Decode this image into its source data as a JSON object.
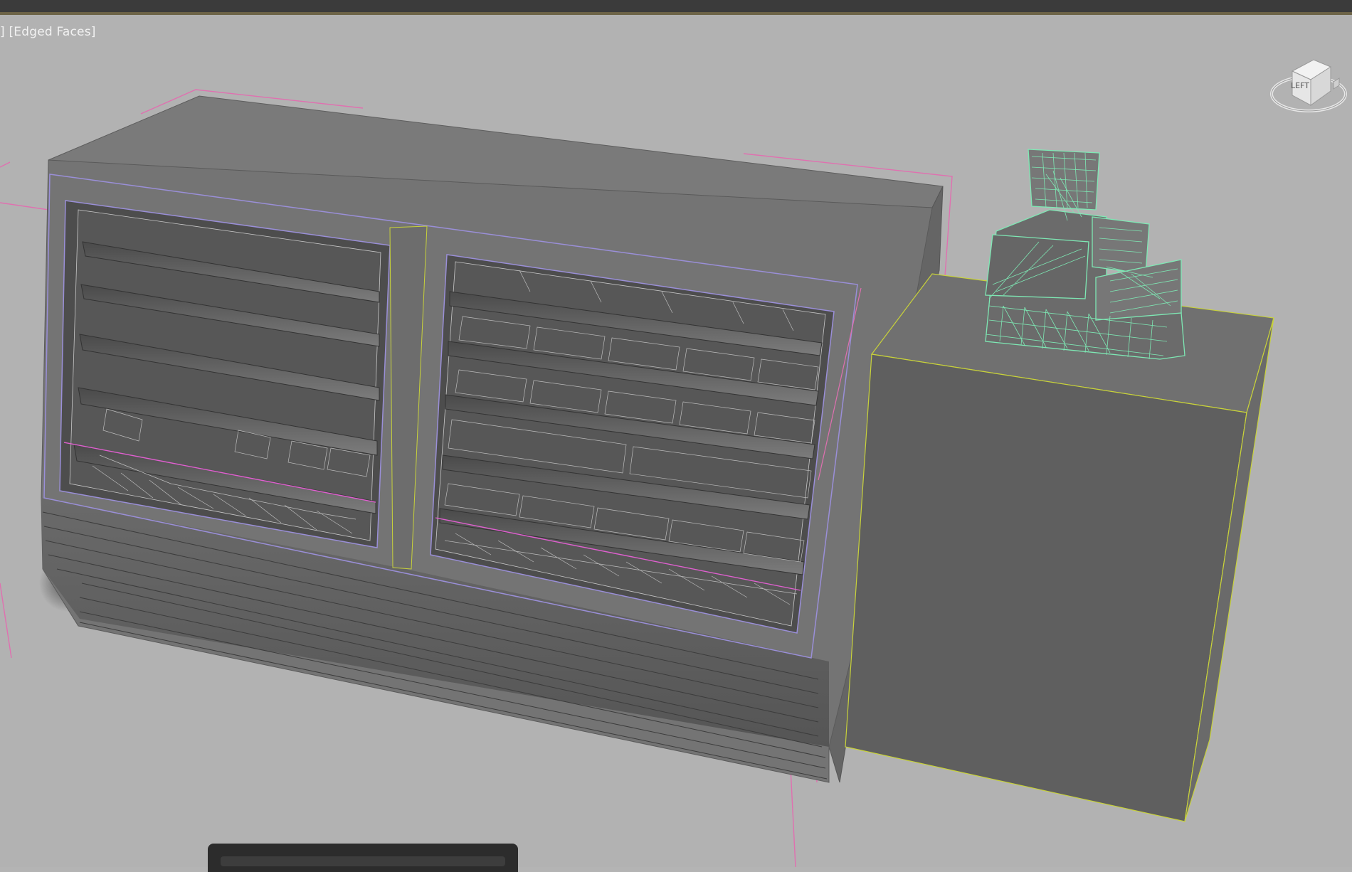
{
  "viewport": {
    "label": "[Edged Faces]",
    "label_prefix": "]"
  },
  "viewcube": {
    "face": "LEFT"
  },
  "colors": {
    "background": "#b2b2b2",
    "fridge_body": "#6e6e6e",
    "selection_wire": "#7ee8b4",
    "bbox_pink": "#e070b0",
    "frame_purple": "#9a8fd8",
    "edge_yellow": "#c8d23a"
  }
}
